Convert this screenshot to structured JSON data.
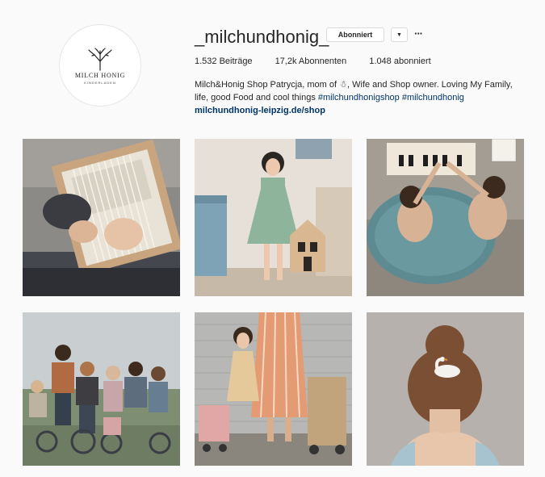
{
  "profile": {
    "logo_text": "MILCH HONIG",
    "logo_sub": "KINDERLADEN",
    "username": "_milchundhonig_",
    "follow_label": "Abonniert",
    "posts": "1.532 Beiträge",
    "followers": "17,2k Abonnenten",
    "following": "1.048 abonniert",
    "bio_line1": "Milch&Honig Shop Patrycja, mom of ",
    "bio_emoji": "☃",
    "bio_line1b": ", Wife and Shop owner. Loving My Family,",
    "bio_line2": "life, good Food and cool things ",
    "tag1": "#milchundhonigshop",
    "tag2": "#milchundhonig",
    "website": "milchundhonig-leipzig.de/shop"
  },
  "colors": {
    "background": "#fafafa",
    "link": "#003569",
    "border": "#dbdbdb"
  }
}
